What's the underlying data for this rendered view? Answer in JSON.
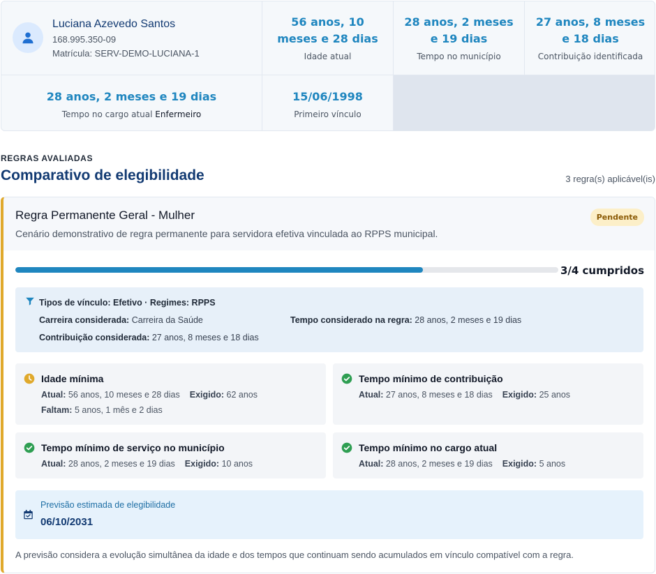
{
  "person": {
    "name": "Luciana Azevedo Santos",
    "cpf": "168.995.350-09",
    "registration": "Matrícula: SERV-DEMO-LUCIANA-1",
    "icon": "user-icon"
  },
  "metrics": [
    {
      "value": "56 anos, 10 meses e 28 dias",
      "label": "Idade atual"
    },
    {
      "value": "28 anos, 2 meses e 19 dias",
      "label": "Tempo no município"
    },
    {
      "value": "27 anos, 8 meses e 18 dias",
      "label": "Contribuição identificada"
    }
  ],
  "cargo": {
    "value": "28 anos, 2 meses e 19 dias",
    "label": "Tempo no cargo atual",
    "role": "Enfermeiro"
  },
  "first_link": {
    "value": "15/06/1998",
    "label": "Primeiro vínculo"
  },
  "section": {
    "kicker": "REGRAS AVALIADAS",
    "title": "Comparativo de elegibilidade",
    "count": "3 regra(s) aplicável(is)"
  },
  "rule": {
    "title": "Regra Permanente Geral - Mulher",
    "description": "Cenário demonstrativo de regra permanente para servidora efetiva vinculada ao RPPS municipal.",
    "status": "Pendente",
    "status_color": "#fcefc8",
    "accent_color": "#e0a92c",
    "progress": {
      "done": 3,
      "total": 4,
      "label": "3/4 cumpridos"
    },
    "scope": {
      "title": "Tipos de vínculo: Efetivo · Regimes: RPPS",
      "career_label": "Carreira considerada:",
      "career_value": "Carreira da Saúde",
      "time_label": "Tempo considerado na regra:",
      "time_value": "28 anos, 2 meses e 19 dias",
      "contrib_label": "Contribuição considerada:",
      "contrib_value": "27 anos, 8 meses e 18 dias"
    },
    "requirements": [
      {
        "title": "Idade mínima",
        "status": "pending",
        "icon": "clock-icon",
        "current_label": "Atual:",
        "current": "56 anos, 10 meses e 28 dias",
        "required_label": "Exigido:",
        "required": "62 anos",
        "missing_label": "Faltam:",
        "missing": "5 anos, 1 mês e 2 dias"
      },
      {
        "title": "Tempo mínimo de contribuição",
        "status": "met",
        "icon": "check-circle-icon",
        "current_label": "Atual:",
        "current": "27 anos, 8 meses e 18 dias",
        "required_label": "Exigido:",
        "required": "25 anos"
      },
      {
        "title": "Tempo mínimo de serviço no município",
        "status": "met",
        "icon": "check-circle-icon",
        "current_label": "Atual:",
        "current": "28 anos, 2 meses e 19 dias",
        "required_label": "Exigido:",
        "required": "10 anos"
      },
      {
        "title": "Tempo mínimo no cargo atual",
        "status": "met",
        "icon": "check-circle-icon",
        "current_label": "Atual:",
        "current": "28 anos, 2 meses e 19 dias",
        "required_label": "Exigido:",
        "required": "5 anos"
      }
    ],
    "forecast": {
      "label": "Previsão estimada de elegibilidade",
      "date": "06/10/2031",
      "icon": "calendar-check-icon"
    },
    "footnote": "A previsão considera a evolução simultânea da idade e dos tempos que continuam sendo acumulados em vínculo compatível com a regra."
  }
}
